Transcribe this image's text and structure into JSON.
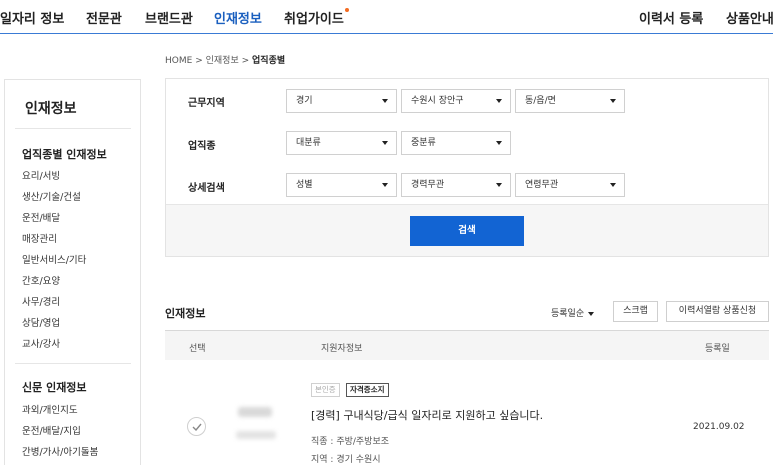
{
  "nav": {
    "left": [
      "일자리 정보",
      "전문관",
      "브랜드관",
      "인재정보",
      "취업가이드"
    ],
    "right": [
      "이력서 등록",
      "상품안내"
    ]
  },
  "breadcrumb": {
    "home": "HOME",
    "sep": ">",
    "level1": "인재정보",
    "current": "업직종별"
  },
  "sidebar": {
    "title": "인재정보",
    "section1": "업직종별 인재정보",
    "items1": [
      "요리/서빙",
      "생산/기술/건설",
      "운전/배달",
      "매장관리",
      "일반서비스/기타",
      "간호/요양",
      "사무/경리",
      "상담/영업",
      "교사/강사"
    ],
    "section2": "신문 인재정보",
    "items2": [
      "과외/개인지도",
      "운전/배달/지입",
      "간병/가사/아기돌봄"
    ]
  },
  "filters": {
    "region_label": "근무지역",
    "region": [
      "경기",
      "수원시 장안구",
      "동/읍/면"
    ],
    "job_label": "업직종",
    "job": [
      "대분류",
      "중분류"
    ],
    "detail_label": "상세검색",
    "detail": [
      "성별",
      "경력무관",
      "연령무관"
    ],
    "search_button": "검색"
  },
  "results": {
    "title": "인재정보",
    "sort": "등록일순",
    "scrap_button": "스크랩",
    "apply_button": "이력서열람 상품신청",
    "headers": {
      "select": "선택",
      "info": "지원자정보",
      "date": "등록일"
    },
    "rows": [
      {
        "badge_verify": "본인증",
        "badge_cert": "자격증소지",
        "title": "[경력] 구내식당/급식 일자리로 지원하고 싶습니다.",
        "job": "직종 : 주방/주방보조",
        "region": "지역 : 경기 수원시",
        "date": "2021.09.02"
      }
    ]
  },
  "colors": {
    "accent": "#1264d3",
    "nav_active": "#1a5fbf",
    "new_dot": "#f36b21"
  }
}
